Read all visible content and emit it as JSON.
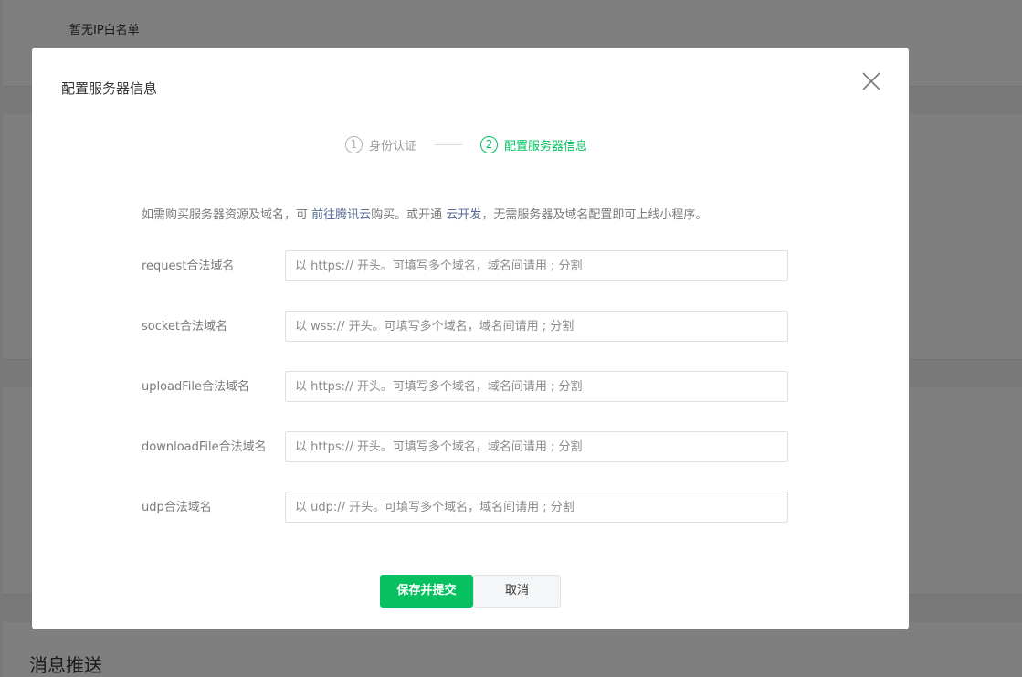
{
  "background": {
    "whitelist_empty": "暂无IP白名单",
    "section_title": "消息推送"
  },
  "dialog": {
    "title": "配置服务器信息",
    "close_icon": "close-icon"
  },
  "steps": [
    {
      "number": "1",
      "label": "身份认证",
      "active": false
    },
    {
      "number": "2",
      "label": "配置服务器信息",
      "active": true
    }
  ],
  "tip": {
    "prefix": "如需购买服务器资源及域名，可 ",
    "link1": "前往腾讯云",
    "middle": "购买。或开通 ",
    "link2": "云开发",
    "suffix": "，无需服务器及域名配置即可上线小程序。"
  },
  "form": {
    "fields": [
      {
        "label": "request合法域名",
        "placeholder": "以 https:// 开头。可填写多个域名，域名间请用 ; 分割",
        "value": ""
      },
      {
        "label": "socket合法域名",
        "placeholder": "以 wss:// 开头。可填写多个域名，域名间请用 ; 分割",
        "value": ""
      },
      {
        "label": "uploadFile合法域名",
        "placeholder": "以 https:// 开头。可填写多个域名，域名间请用 ; 分割",
        "value": ""
      },
      {
        "label": "downloadFile合法域名",
        "placeholder": "以 https:// 开头。可填写多个域名，域名间请用 ; 分割",
        "value": ""
      },
      {
        "label": "udp合法域名",
        "placeholder": "以 udp:// 开头。可填写多个域名，域名间请用 ; 分割",
        "value": ""
      }
    ]
  },
  "buttons": {
    "submit": "保存并提交",
    "cancel": "取消"
  },
  "colors": {
    "accent": "#07c160",
    "link": "#576b95",
    "overlay": "rgba(0,0,0,0.5)"
  }
}
